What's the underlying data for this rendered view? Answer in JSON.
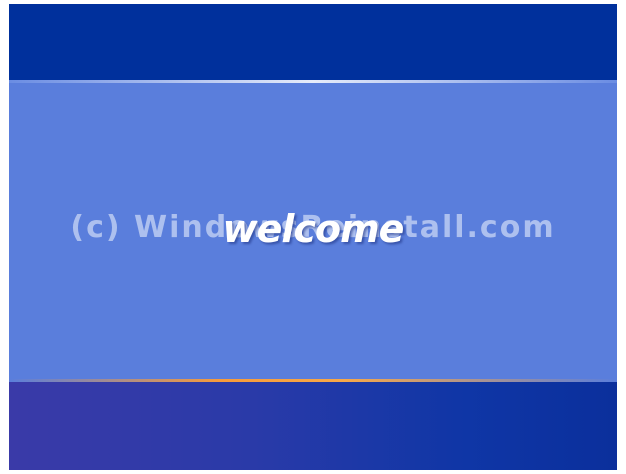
{
  "screen": {
    "greeting": "welcome",
    "watermark": "(c) WindowsReinstall.com"
  },
  "colors": {
    "top_bar": "#00309c",
    "center_panel": "#5a7edc",
    "accent_line": "#f89b3a",
    "bottom_bar": "#0f36a6"
  }
}
